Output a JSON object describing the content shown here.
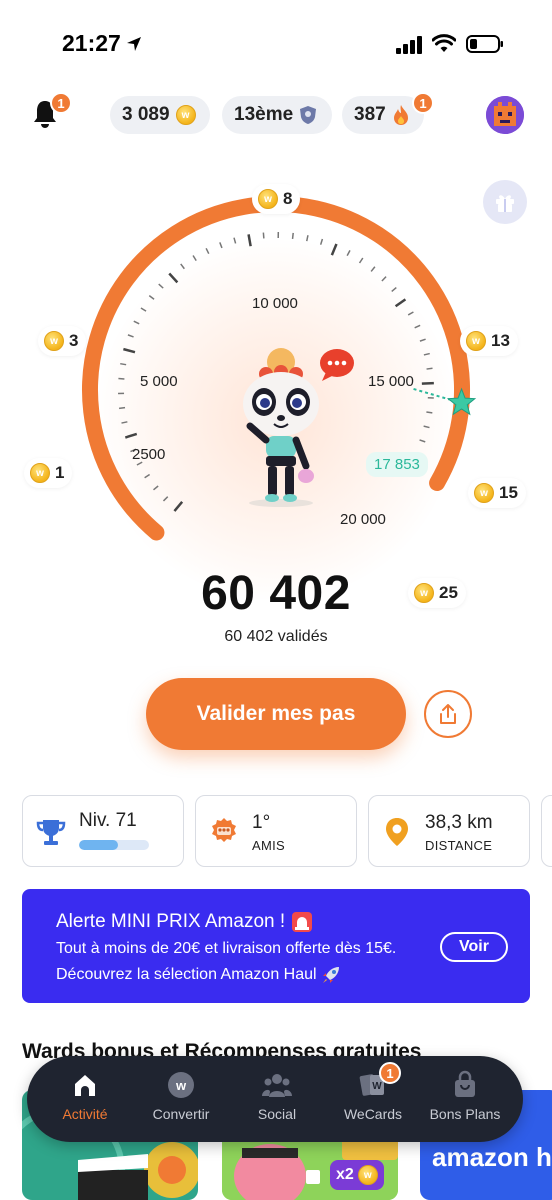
{
  "status_bar": {
    "time": "21:27"
  },
  "header": {
    "notifications_count": "1",
    "coins": "3 089",
    "rank": "13ème",
    "streak": "387",
    "streak_badge": "1"
  },
  "gauge": {
    "scale": [
      "2500",
      "5 000",
      "10 000",
      "15 000",
      "20 000"
    ],
    "milestones": [
      {
        "value": "1"
      },
      {
        "value": "3"
      },
      {
        "value": "8"
      },
      {
        "value": "13"
      },
      {
        "value": "15"
      },
      {
        "value": "25"
      }
    ],
    "friend_steps": "17 853",
    "steps_total": "60 402",
    "steps_validated": "60 402 validés",
    "progress": 0.9,
    "accent_color": "#f07a34"
  },
  "cta": {
    "validate_label": "Valider mes pas"
  },
  "stats": {
    "level_label": "Niv. 71",
    "level_progress": 0.55,
    "friends_rank": "1°",
    "friends_label": "AMIS",
    "distance_value": "38,3 km",
    "distance_label": "DISTANCE"
  },
  "promo": {
    "title": "Alerte MINI PRIX Amazon !",
    "line1": "Tout à moins de 20€ et livraison offerte dès 15€.",
    "line2": "Découvrez la sélection Amazon Haul",
    "button": "Voir",
    "background": "#3a2cf0"
  },
  "section": {
    "title": "Wards bonus et Récompenses gratuites"
  },
  "thumbnails": {
    "x2_label": "x2",
    "amazon_label": "amazon ha"
  },
  "bottom_nav": {
    "items": [
      {
        "label": "Activité",
        "icon": "home-icon"
      },
      {
        "label": "Convertir",
        "icon": "coin-icon"
      },
      {
        "label": "Social",
        "icon": "people-icon"
      },
      {
        "label": "WeCards",
        "icon": "cards-icon",
        "badge": "1"
      },
      {
        "label": "Bons Plans",
        "icon": "bag-icon"
      }
    ]
  }
}
